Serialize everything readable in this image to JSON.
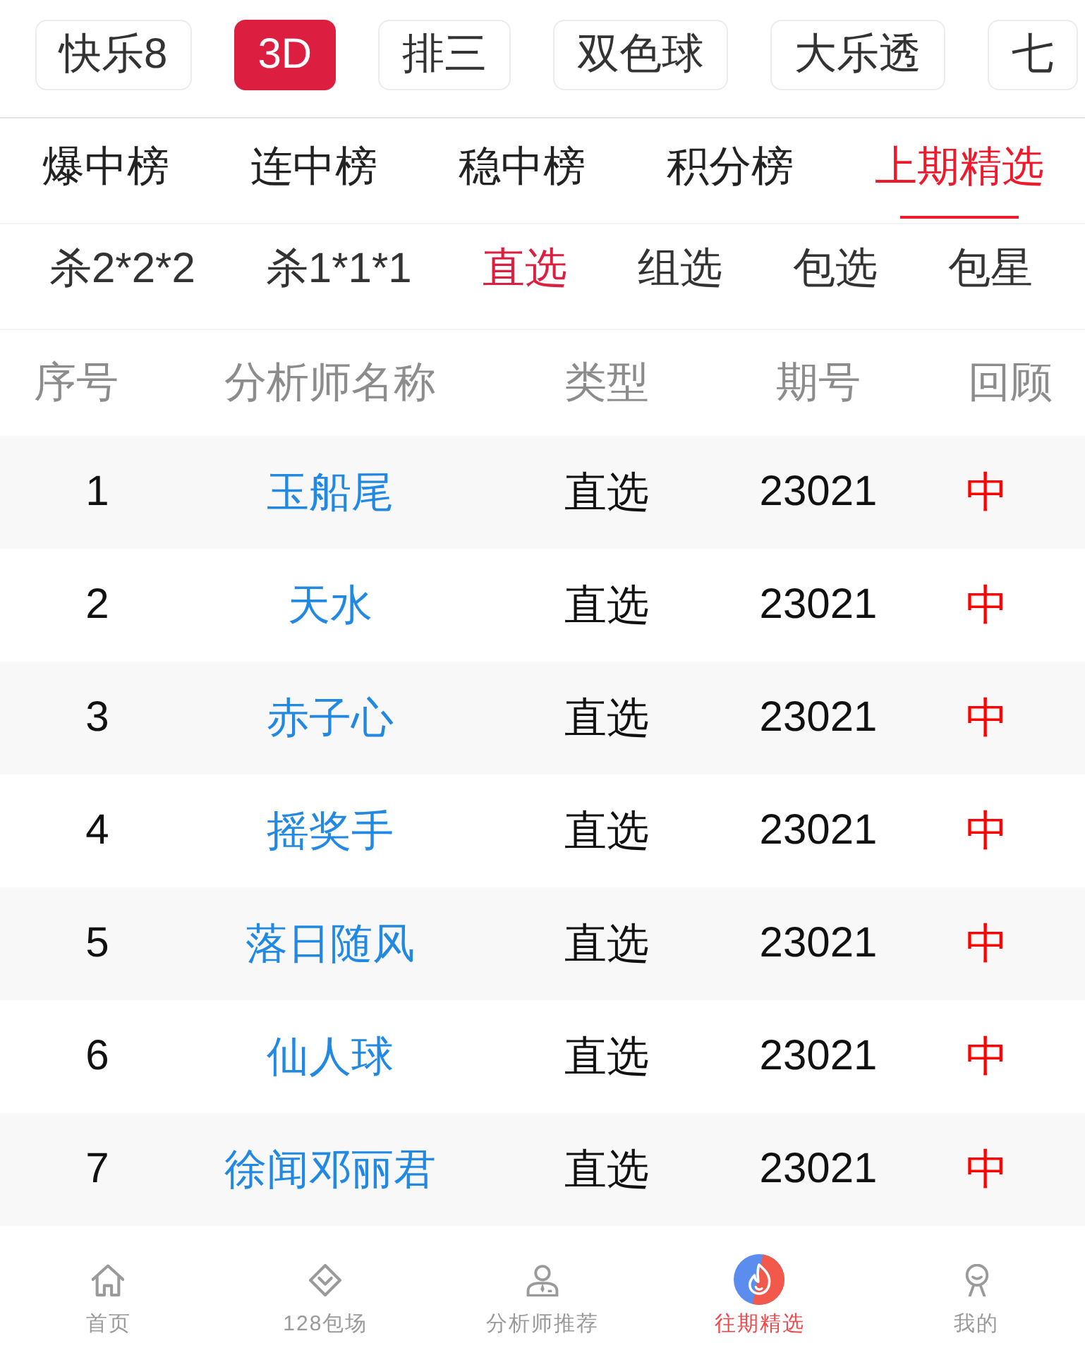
{
  "lottery_tabs": [
    {
      "label": "快乐8",
      "selected": false
    },
    {
      "label": "3D",
      "selected": true
    },
    {
      "label": "排三",
      "selected": false
    },
    {
      "label": "双色球",
      "selected": false
    },
    {
      "label": "大乐透",
      "selected": false
    },
    {
      "label": "七",
      "selected": false
    }
  ],
  "rank_tabs": [
    {
      "label": "爆中榜",
      "selected": false
    },
    {
      "label": "连中榜",
      "selected": false
    },
    {
      "label": "稳中榜",
      "selected": false
    },
    {
      "label": "积分榜",
      "selected": false
    },
    {
      "label": "上期精选",
      "selected": true
    }
  ],
  "play_tabs": [
    {
      "label": "杀2*2*2",
      "selected": false
    },
    {
      "label": "杀1*1*1",
      "selected": false
    },
    {
      "label": "直选",
      "selected": true
    },
    {
      "label": "组选",
      "selected": false
    },
    {
      "label": "包选",
      "selected": false
    },
    {
      "label": "包星",
      "selected": false
    }
  ],
  "table": {
    "columns": [
      "序号",
      "分析师名称",
      "类型",
      "期号",
      "回顾"
    ],
    "rows": [
      {
        "no": "1",
        "analyst": "玉船尾",
        "type": "直选",
        "issue": "23021",
        "review": "中"
      },
      {
        "no": "2",
        "analyst": "天水",
        "type": "直选",
        "issue": "23021",
        "review": "中"
      },
      {
        "no": "3",
        "analyst": "赤子心",
        "type": "直选",
        "issue": "23021",
        "review": "中"
      },
      {
        "no": "4",
        "analyst": "摇奖手",
        "type": "直选",
        "issue": "23021",
        "review": "中"
      },
      {
        "no": "5",
        "analyst": "落日随风",
        "type": "直选",
        "issue": "23021",
        "review": "中"
      },
      {
        "no": "6",
        "analyst": "仙人球",
        "type": "直选",
        "issue": "23021",
        "review": "中"
      },
      {
        "no": "7",
        "analyst": "徐闻邓丽君",
        "type": "直选",
        "issue": "23021",
        "review": "中"
      }
    ]
  },
  "bottom_nav": [
    {
      "label": "首页",
      "kind": "home",
      "selected": false
    },
    {
      "label": "128包场",
      "kind": "diamond",
      "selected": false
    },
    {
      "label": "分析师推荐",
      "kind": "analyst",
      "selected": false
    },
    {
      "label": "往期精选",
      "kind": "flame",
      "selected": true
    },
    {
      "label": "我的",
      "kind": "person",
      "selected": false
    }
  ]
}
